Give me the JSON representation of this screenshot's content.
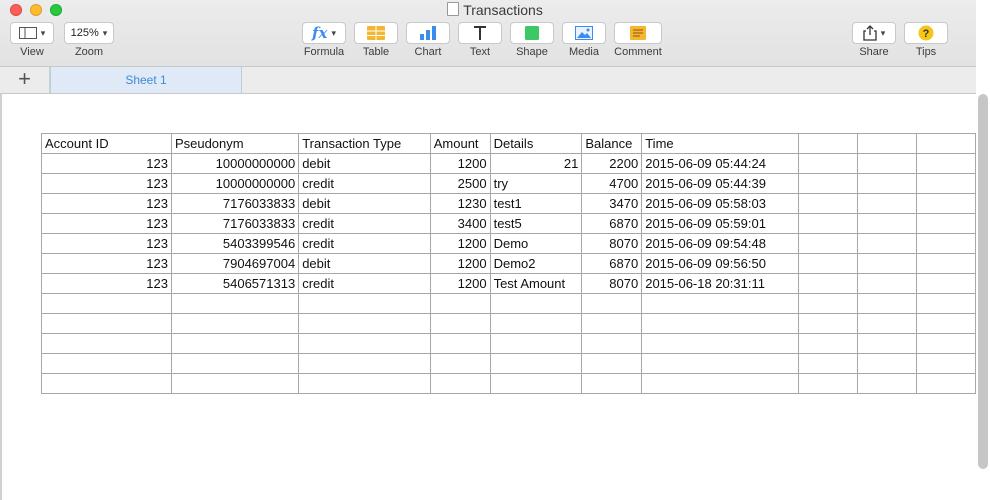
{
  "window": {
    "title": "Transactions"
  },
  "toolbar": {
    "view_label": "View",
    "zoom_label": "Zoom",
    "zoom_value": "125%",
    "formula_label": "Formula",
    "table_label": "Table",
    "chart_label": "Chart",
    "text_label": "Text",
    "shape_label": "Shape",
    "media_label": "Media",
    "comment_label": "Comment",
    "share_label": "Share",
    "tips_label": "Tips"
  },
  "tabs": {
    "add_symbol": "+",
    "sheet1": "Sheet 1"
  },
  "table": {
    "headers": [
      "Account ID",
      "Pseudonym",
      "Transaction Type",
      "Amount",
      "Details",
      "Balance",
      "Time",
      "",
      "",
      ""
    ],
    "rows": [
      [
        "123",
        "10000000000",
        "debit",
        "1200",
        "21",
        "2200",
        "2015-06-09 05:44:24",
        "",
        "",
        ""
      ],
      [
        "123",
        "10000000000",
        "credit",
        "2500",
        "try",
        "4700",
        "2015-06-09 05:44:39",
        "",
        "",
        ""
      ],
      [
        "123",
        "7176033833",
        "debit",
        "1230",
        "test1",
        "3470",
        "2015-06-09 05:58:03",
        "",
        "",
        ""
      ],
      [
        "123",
        "7176033833",
        "credit",
        "3400",
        "test5",
        "6870",
        "2015-06-09 05:59:01",
        "",
        "",
        ""
      ],
      [
        "123",
        "5403399546",
        "credit",
        "1200",
        "Demo",
        "8070",
        "2015-06-09 09:54:48",
        "",
        "",
        ""
      ],
      [
        "123",
        "7904697004",
        "debit",
        "1200",
        "Demo2",
        "6870",
        "2015-06-09 09:56:50",
        "",
        "",
        ""
      ],
      [
        "123",
        "5406571313",
        "credit",
        "1200",
        "Test Amount",
        "8070",
        "2015-06-18 20:31:11",
        "",
        "",
        ""
      ],
      [
        "",
        "",
        "",
        "",
        "",
        "",
        "",
        "",
        "",
        ""
      ],
      [
        "",
        "",
        "",
        "",
        "",
        "",
        "",
        "",
        "",
        ""
      ],
      [
        "",
        "",
        "",
        "",
        "",
        "",
        "",
        "",
        "",
        ""
      ],
      [
        "",
        "",
        "",
        "",
        "",
        "",
        "",
        "",
        "",
        ""
      ],
      [
        "",
        "",
        "",
        "",
        "",
        "",
        "",
        "",
        "",
        ""
      ]
    ]
  },
  "colors": {
    "sheet_tab_text": "#3f8ad8",
    "chart_icon": "#3b8cf0",
    "shape_icon": "#3cc864",
    "table_icon": "#f4b630",
    "comment_icon": "#f4b630",
    "tips_icon": "#f5c518"
  }
}
